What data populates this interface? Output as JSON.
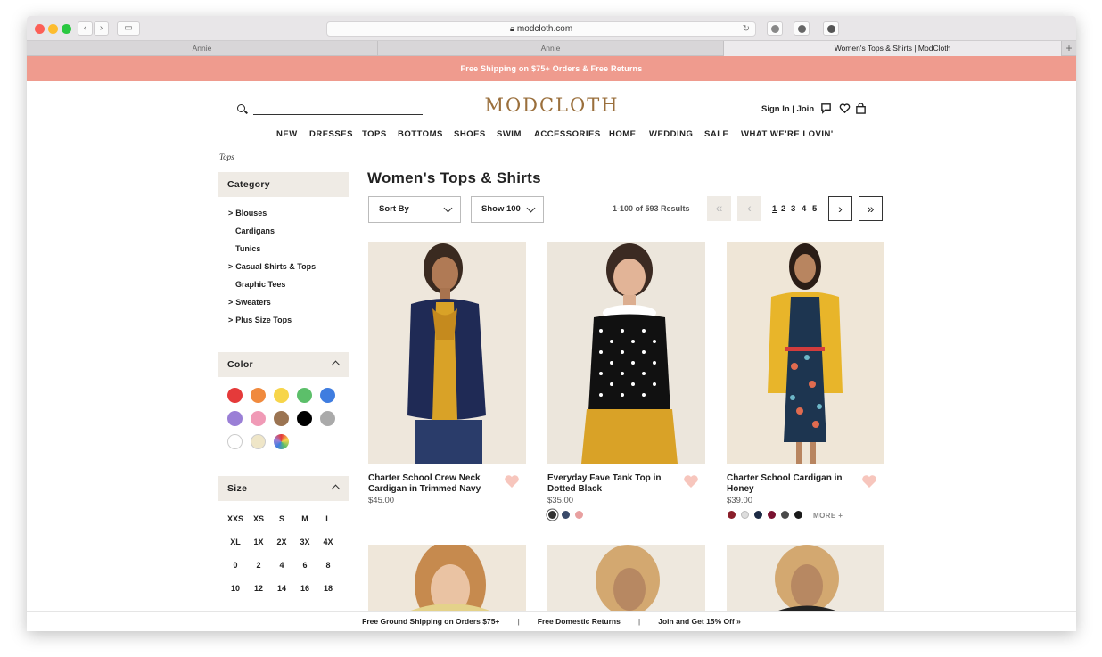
{
  "browser": {
    "url": "modcloth.com",
    "tabs": [
      "Annie",
      "Annie",
      "Women's Tops & Shirts | ModCloth"
    ],
    "new_tab_glyph": "+"
  },
  "promo": "Free Shipping on $75+ Orders & Free Returns",
  "header": {
    "logo": "MODCLOTH",
    "sign_in": "Sign In | Join",
    "icons": [
      "search-icon",
      "chat-icon",
      "heart-icon",
      "bag-icon"
    ]
  },
  "nav": [
    "NEW",
    "DRESSES",
    "TOPS",
    "BOTTOMS",
    "SHOES",
    "SWIM",
    "ACCESSORIES",
    "HOME",
    "WEDDING",
    "SALE",
    "WHAT WE'RE LOVIN'"
  ],
  "breadcrumb": "Tops",
  "sidebar": {
    "category_title": "Category",
    "categories": [
      {
        "label": "Blouses",
        "expand": ">"
      },
      {
        "label": "Cardigans",
        "expand": ""
      },
      {
        "label": "Tunics",
        "expand": ""
      },
      {
        "label": "Casual Shirts & Tops",
        "expand": ">"
      },
      {
        "label": "Graphic Tees",
        "expand": ""
      },
      {
        "label": "Sweaters",
        "expand": ">"
      },
      {
        "label": "Plus Size Tops",
        "expand": ">"
      }
    ],
    "color_title": "Color",
    "colors": [
      "#e53a3a",
      "#f08a3e",
      "#f7d54a",
      "#5cbf6a",
      "#3f7de0",
      "#9a7fd6",
      "#f09ab6",
      "#9b7452",
      "#000000",
      "#aaaaaa",
      "#ffffff",
      "#efe6c8",
      "rainbow"
    ],
    "size_title": "Size",
    "sizes": [
      [
        "XXS",
        "XS",
        "S",
        "M",
        "L"
      ],
      [
        "XL",
        "1X",
        "2X",
        "3X",
        "4X"
      ],
      [
        "0",
        "2",
        "4",
        "6",
        "8"
      ],
      [
        "10",
        "12",
        "14",
        "16",
        "18"
      ]
    ]
  },
  "main": {
    "title": "Women's Tops & Shirts",
    "sort_label": "Sort By",
    "show_label": "Show 100",
    "results": "1-100 of 593 Results",
    "pages": [
      "1",
      "2",
      "3",
      "4",
      "5"
    ],
    "current_page": "1",
    "first_glyph": "«",
    "prev_glyph": "‹",
    "next_glyph": "›",
    "last_glyph": "»"
  },
  "products": [
    {
      "name": "Charter School Crew Neck Cardigan in Trimmed Navy",
      "price": "$45.00",
      "swatches": []
    },
    {
      "name": "Everyday Fave Tank Top in Dotted Black",
      "price": "$35.00",
      "swatches": [
        "#333333",
        "#3a4a6a",
        "#e8a0a0"
      ]
    },
    {
      "name": "Charter School Cardigan in Honey",
      "price": "$39.00",
      "swatches": [
        "#8a1f2a",
        "#dddddd",
        "#1c2a44",
        "#7a1230",
        "#4a4a4a",
        "#1a1a1a"
      ],
      "more": "MORE +"
    }
  ],
  "footer": [
    "Free Ground Shipping on Orders $75+",
    "Free Domestic Returns",
    "Join and Get 15% Off »"
  ],
  "accent": "#ef9b8e",
  "logo_color": "#9a6f3c"
}
